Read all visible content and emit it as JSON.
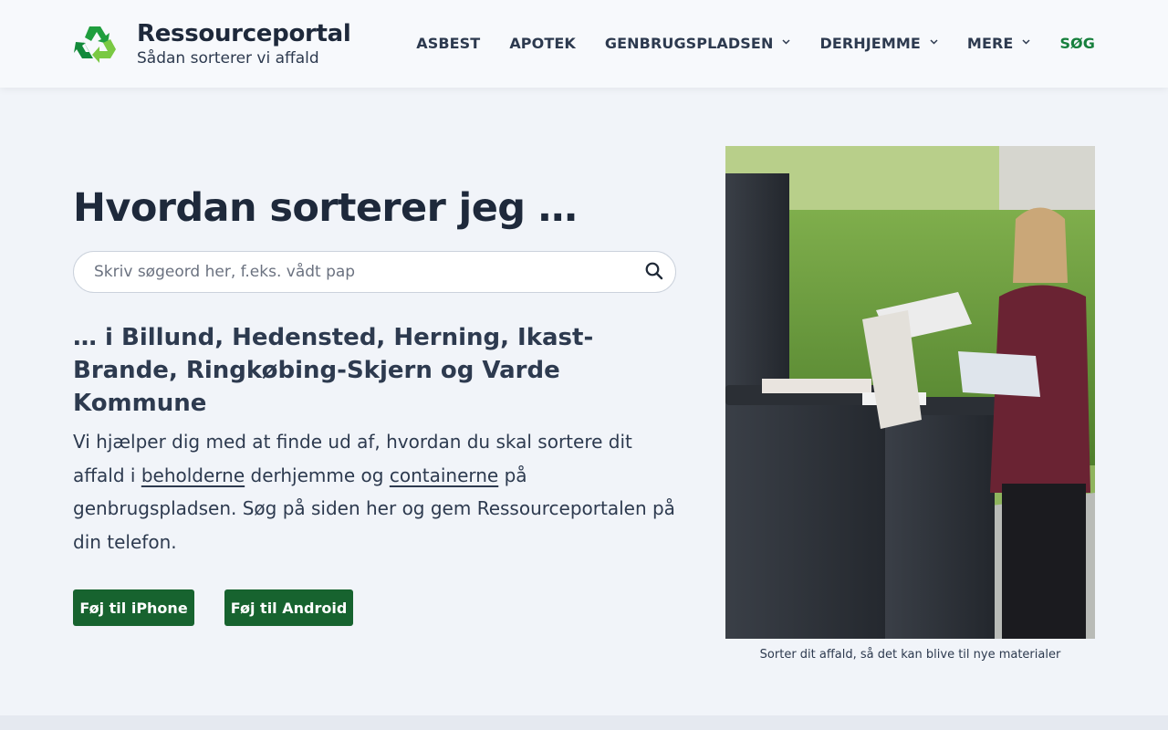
{
  "header": {
    "brand_title": "Ressourceportal",
    "brand_subtitle": "Sådan sorterer vi affald",
    "nav": [
      {
        "label": "ASBEST",
        "has_dropdown": false
      },
      {
        "label": "APOTEK",
        "has_dropdown": false
      },
      {
        "label": "GENBRUGSPLADSEN",
        "has_dropdown": true
      },
      {
        "label": "DERHJEMME",
        "has_dropdown": true
      },
      {
        "label": "MERE",
        "has_dropdown": true
      },
      {
        "label": "SØG",
        "has_dropdown": false
      }
    ]
  },
  "main": {
    "heading": "Hvordan sorterer jeg …",
    "search": {
      "placeholder": "Skriv søgeord her, f.eks. vådt pap",
      "value": ""
    },
    "subheading": "… i Billund, Hedensted, Herning, Ikast-Brande, Ringkøbing-Skjern og Varde Kommune",
    "intro": {
      "part1": "Vi hjælper dig med at finde ud af, hvordan du skal sortere dit affald i ",
      "link1": "beholderne",
      "part2": " derhjemme og ",
      "link2": "containerne",
      "part3": " på genbrugspladsen. Søg på siden her og gem Ressourceportalen på din telefon."
    },
    "buttons": {
      "iphone": "Føj til iPhone",
      "android": "Føj til Android"
    }
  },
  "figure": {
    "caption": "Sorter dit affald, så det kan blive til nye materialer"
  },
  "colors": {
    "accent_green": "#17803d",
    "button_green": "#17632f",
    "text_dark": "#1e293b",
    "page_bg": "#f1f4f9"
  },
  "icons": {
    "logo": "recycle-icon",
    "search": "search-icon",
    "dropdown": "chevron-down-icon"
  }
}
